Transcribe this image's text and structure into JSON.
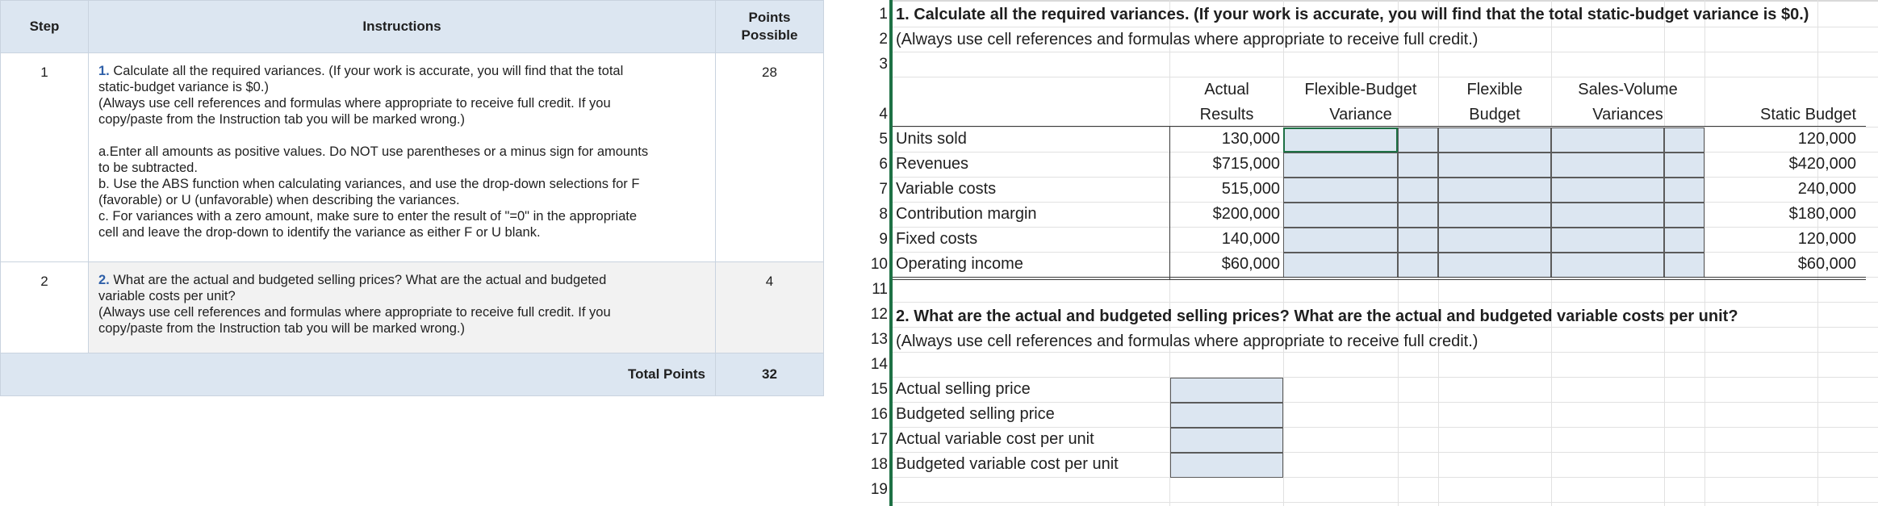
{
  "instructions": {
    "headers": {
      "step": "Step",
      "instructions": "Instructions",
      "points": "Points Possible"
    },
    "rows": [
      {
        "step": "1",
        "number": "1.",
        "lines": [
          "Calculate all the required variances. (If your work is accurate, you will find that the total",
          "static-budget variance is $0.)",
          "(Always use cell references and formulas where appropriate to receive full credit. If you",
          "copy/paste from the Instruction tab you will be marked wrong.)"
        ],
        "sublines": [
          "a.Enter all amounts as positive values. Do NOT use parentheses or a minus sign for amounts",
          "to be subtracted.",
          "b. Use the ABS function when calculating variances, and use the drop-down selections for F",
          "(favorable) or U (unfavorable) when describing the variances.",
          "c. For variances with a zero amount, make sure to enter the result of \"=0\" in the appropriate",
          "cell and leave the drop-down to identify the variance as either F or U blank."
        ],
        "points": "28"
      },
      {
        "step": "2",
        "number": "2.",
        "lines": [
          "What are the actual and budgeted selling prices? What are the actual and budgeted",
          "variable costs per unit?",
          "(Always use cell references and formulas where appropriate to receive full credit. If you",
          "copy/paste from the Instruction tab you will be marked wrong.)"
        ],
        "points": "4"
      }
    ],
    "total_label": "Total Points",
    "total_value": "32"
  },
  "sheet": {
    "row_numbers": [
      "1",
      "2",
      "3",
      "4",
      "5",
      "6",
      "7",
      "8",
      "9",
      "10",
      "11",
      "12",
      "13",
      "14",
      "15",
      "16",
      "17",
      "18",
      "19"
    ],
    "r1": "1. Calculate all the required variances. (If your work is accurate, you will find that the total static-budget variance is $0.)",
    "r2": "(Always use cell references and formulas where appropriate to receive full credit.)",
    "headers": {
      "actual": [
        "Actual",
        "Results"
      ],
      "fbv": [
        "Flexible-Budget",
        "Variance"
      ],
      "flex": [
        "Flexible",
        "Budget"
      ],
      "svv": [
        "Sales-Volume",
        "Variances"
      ],
      "static": "Static Budget"
    },
    "lines": [
      {
        "label": "Units sold",
        "actual": "130,000",
        "static": "120,000"
      },
      {
        "label": "Revenues",
        "actual": "$715,000",
        "static": "$420,000"
      },
      {
        "label": "Variable costs",
        "actual": "515,000",
        "static": "240,000"
      },
      {
        "label": "Contribution margin",
        "actual": "$200,000",
        "static": "$180,000"
      },
      {
        "label": "Fixed costs",
        "actual": "140,000",
        "static": "120,000"
      },
      {
        "label": "Operating income",
        "actual": "$60,000",
        "static": "$60,000"
      }
    ],
    "r12": "2. What are the actual and budgeted selling prices? What are the actual and budgeted variable costs per unit?",
    "r13": "(Always use cell references and formulas where appropriate to receive full credit.)",
    "part2": [
      "Actual selling price",
      "Budgeted selling price",
      "Actual variable cost per unit",
      "Budgeted variable cost per unit"
    ]
  }
}
